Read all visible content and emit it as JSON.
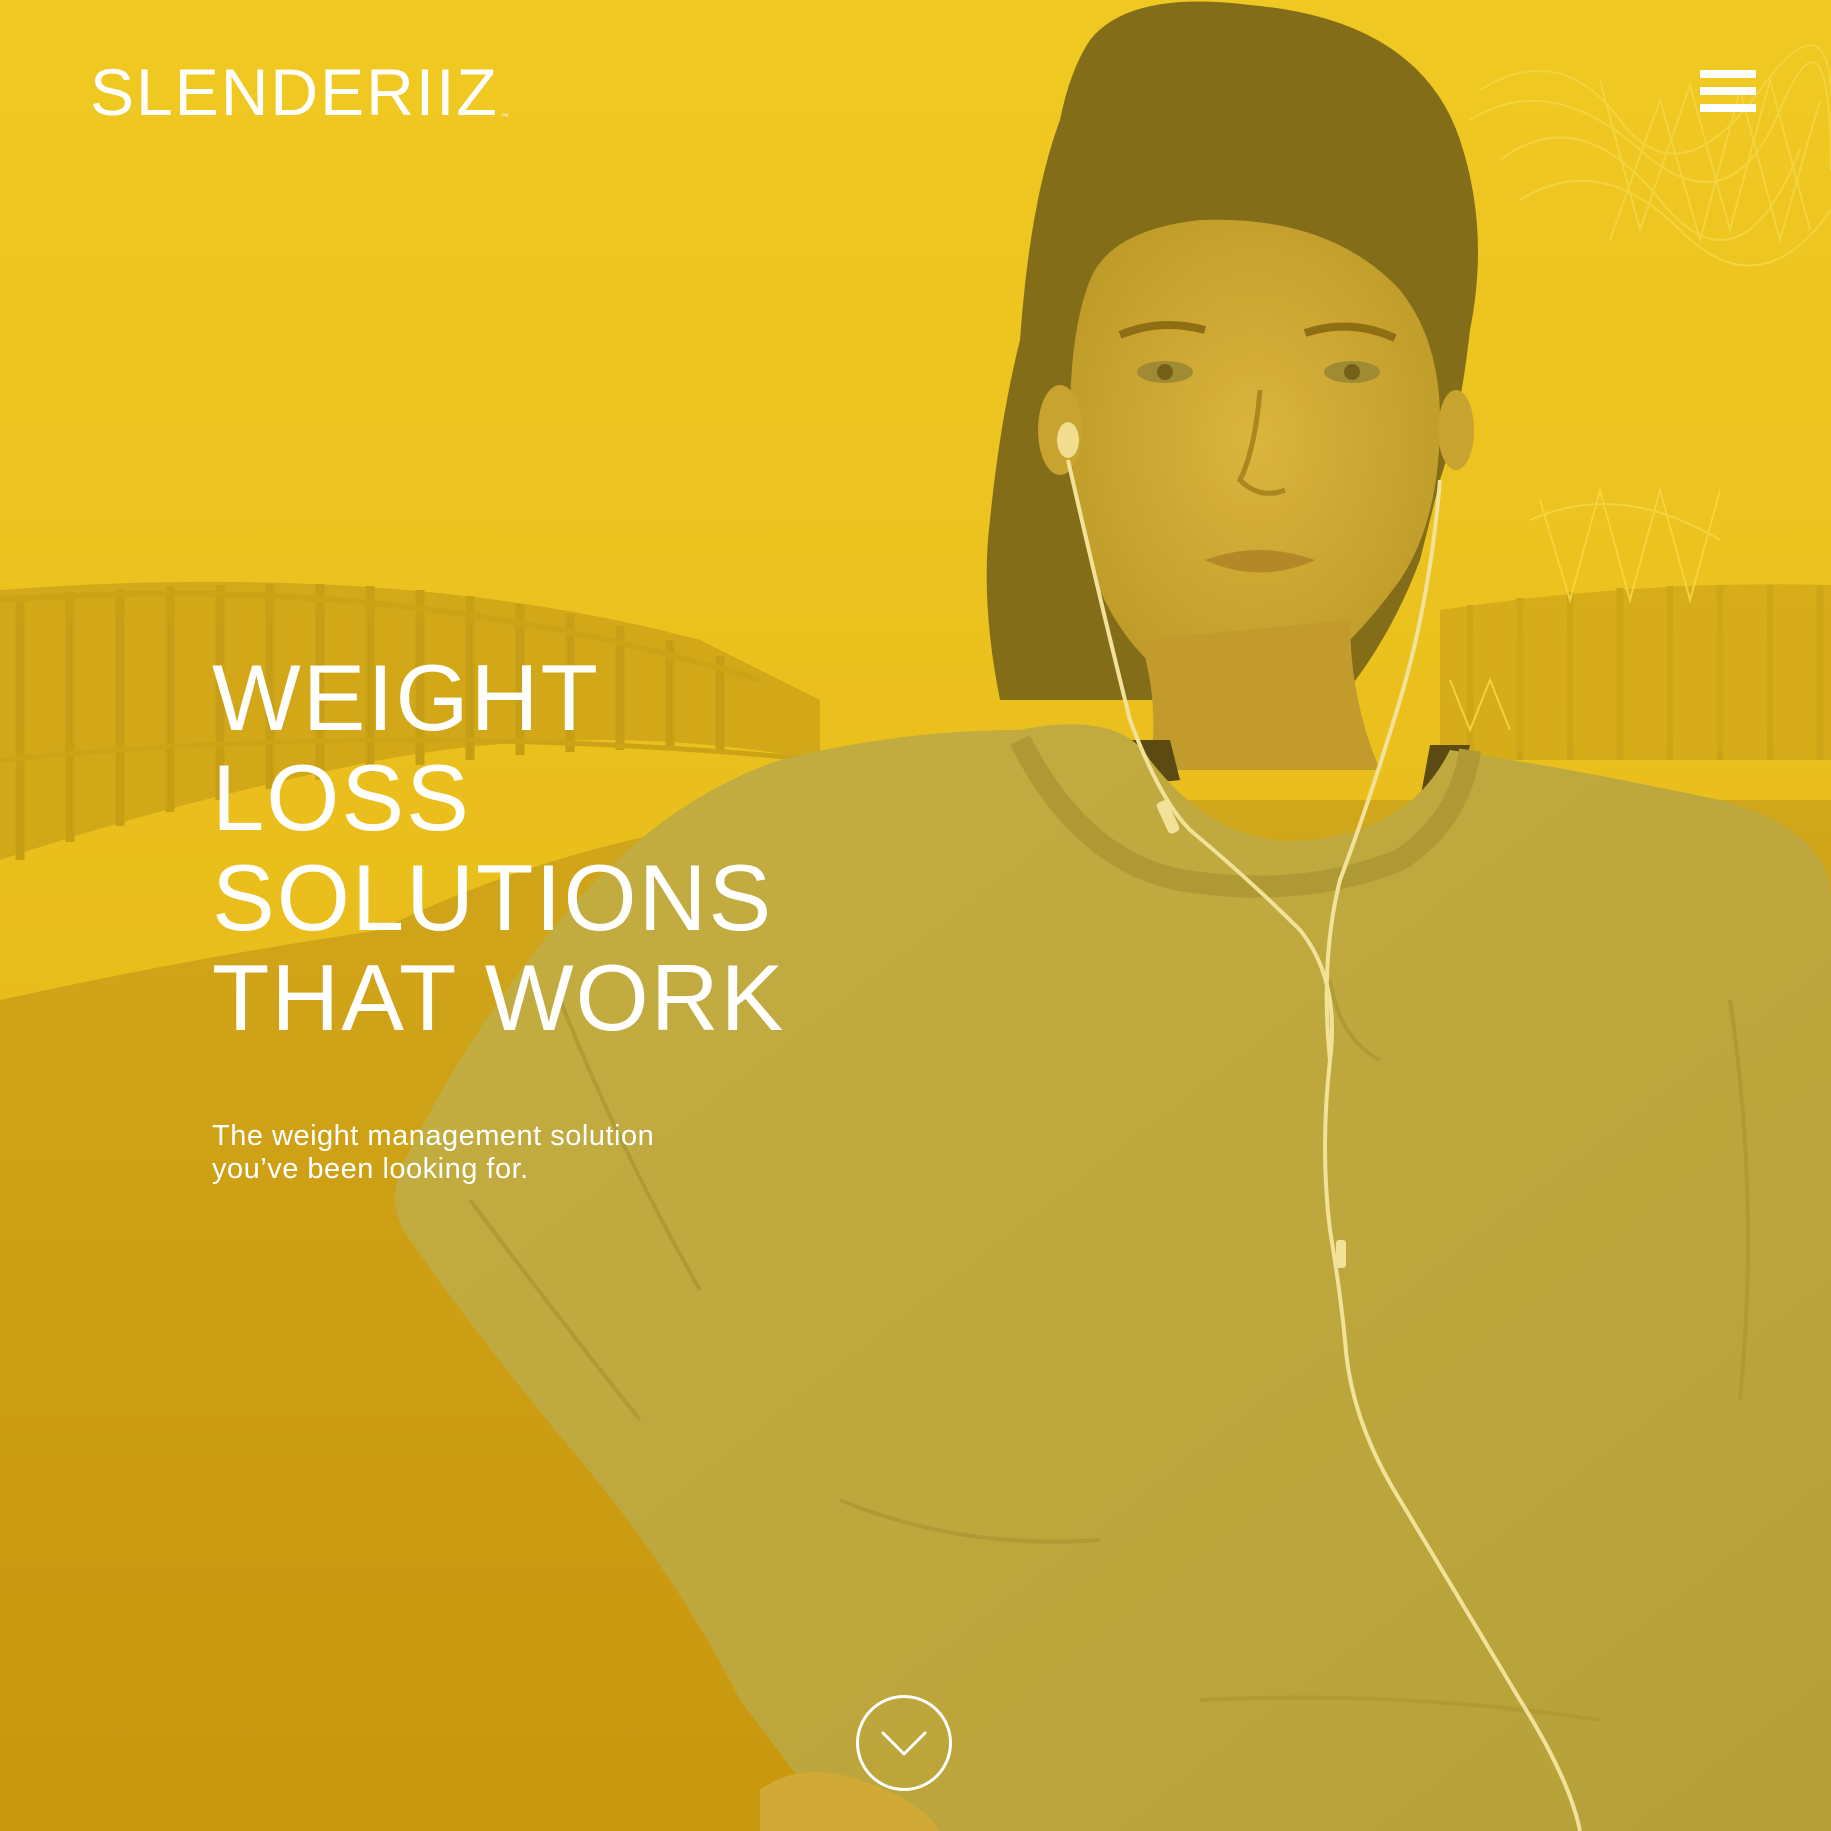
{
  "brand": {
    "logo_text": "SLENDERIIZ",
    "trademark": "™"
  },
  "header": {
    "menu_icon": "hamburger-menu-icon"
  },
  "hero": {
    "headline_lines": [
      "WEIGHT",
      "LOSS",
      "SOLUTIONS",
      "THAT WORK"
    ],
    "subtitle_lines": [
      "The weight management solution",
      "you’ve been looking for."
    ],
    "scroll_icon": "chevron-down-circle-icon"
  },
  "colors": {
    "overlay_yellow": "#e8c21e",
    "overlay_deep": "#d4a20e",
    "text": "#ffffff"
  }
}
